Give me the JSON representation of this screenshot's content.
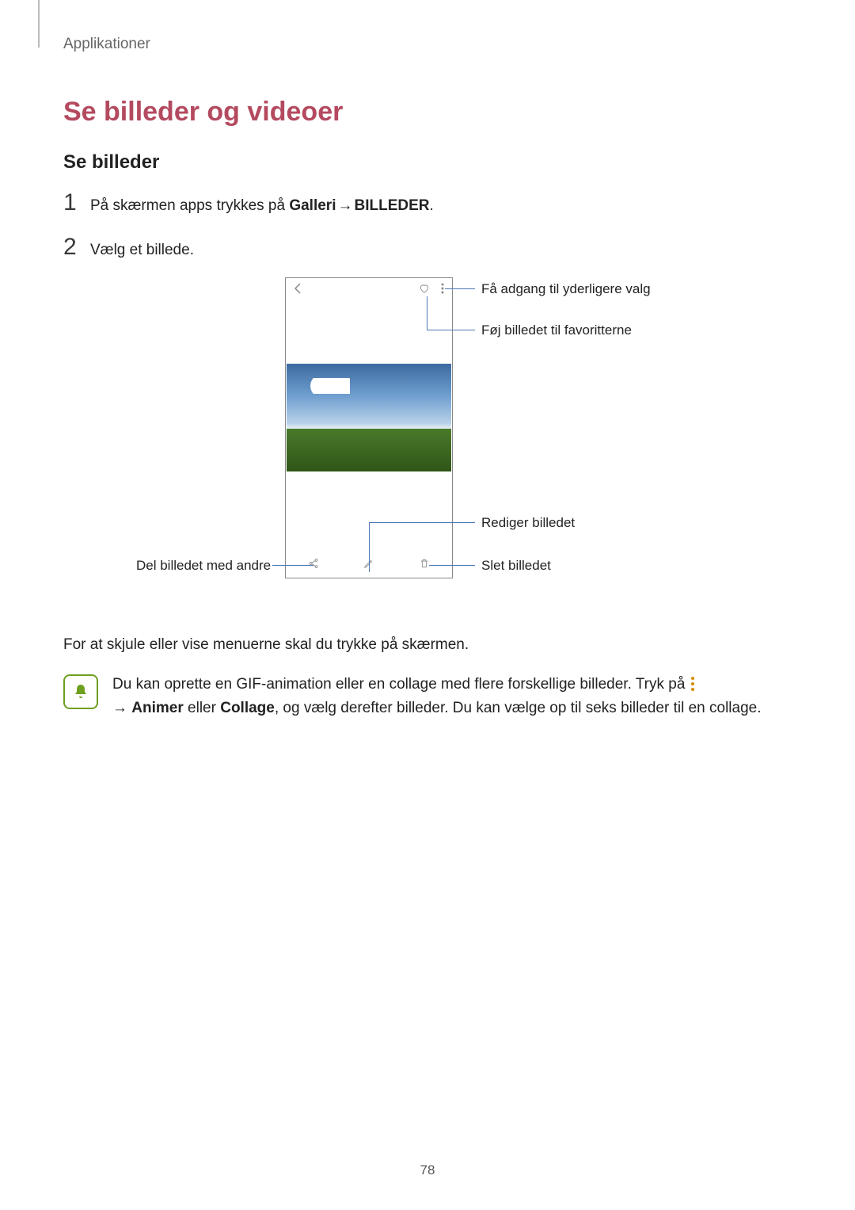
{
  "breadcrumb": "Applikationer",
  "h1": "Se billeder og videoer",
  "h2": "Se billeder",
  "steps": [
    {
      "pre": "På skærmen apps trykkes på ",
      "b1": "Galleri",
      "arrow": " → ",
      "b2": "BILLEDER",
      "post": "."
    },
    {
      "text": "Vælg et billede."
    }
  ],
  "callouts": {
    "more": "Få adgang til yderligere valg",
    "favorite": "Føj billedet til favoritterne",
    "edit": "Rediger billedet",
    "delete": "Slet billedet",
    "share": "Del billedet med andre"
  },
  "para": "For at skjule eller vise menuerne skal du trykke på skærmen.",
  "note": {
    "line1a": "Du kan oprette en GIF-animation eller en collage med flere forskellige billeder. Tryk på ",
    "line2a": "→ ",
    "b1": "Animer",
    "mid": " eller ",
    "b2": "Collage",
    "line2b": ", og vælg derefter billeder. Du kan vælge op til seks billeder til en collage."
  },
  "page": "78"
}
